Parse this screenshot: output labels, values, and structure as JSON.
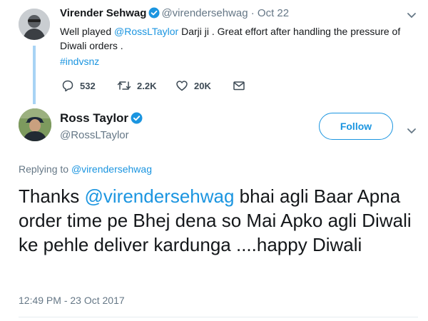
{
  "parent_tweet": {
    "author_name": "Virender Sehwag",
    "author_handle": "@virendersehwag",
    "separator": "·",
    "date": "Oct 22",
    "text_prefix": "Well played ",
    "mention": "@RossLTaylor",
    "text_suffix": " Darji ji . Great effort after handling the pressure of Diwali orders .",
    "hashtag": "#indvsnz",
    "replies": "532",
    "retweets": "2.2K",
    "likes": "20K"
  },
  "main_tweet": {
    "author_name": "Ross Taylor",
    "author_handle": "@RossLTaylor",
    "follow_label": "Follow",
    "replying_prefix": "Replying to ",
    "replying_to": "@virendersehwag",
    "text_prefix": "Thanks ",
    "mention": "@virendersehwag",
    "text_suffix": " bhai agli Baar Apna order time pe Bhej dena so Mai Apko agli Diwali ke pehle deliver  kardunga ....happy Diwali",
    "timestamp": "12:49 PM - 23 Oct 2017"
  },
  "icons": {
    "verified": "verified-badge-icon",
    "caret": "chevron-down-icon",
    "reply": "reply-icon",
    "retweet": "retweet-icon",
    "like": "heart-icon",
    "dm": "direct-message-icon"
  },
  "colors": {
    "accent": "#1b95e0",
    "muted_text": "#657786",
    "thread_line": "#a8d3f4",
    "text": "#14171a"
  }
}
